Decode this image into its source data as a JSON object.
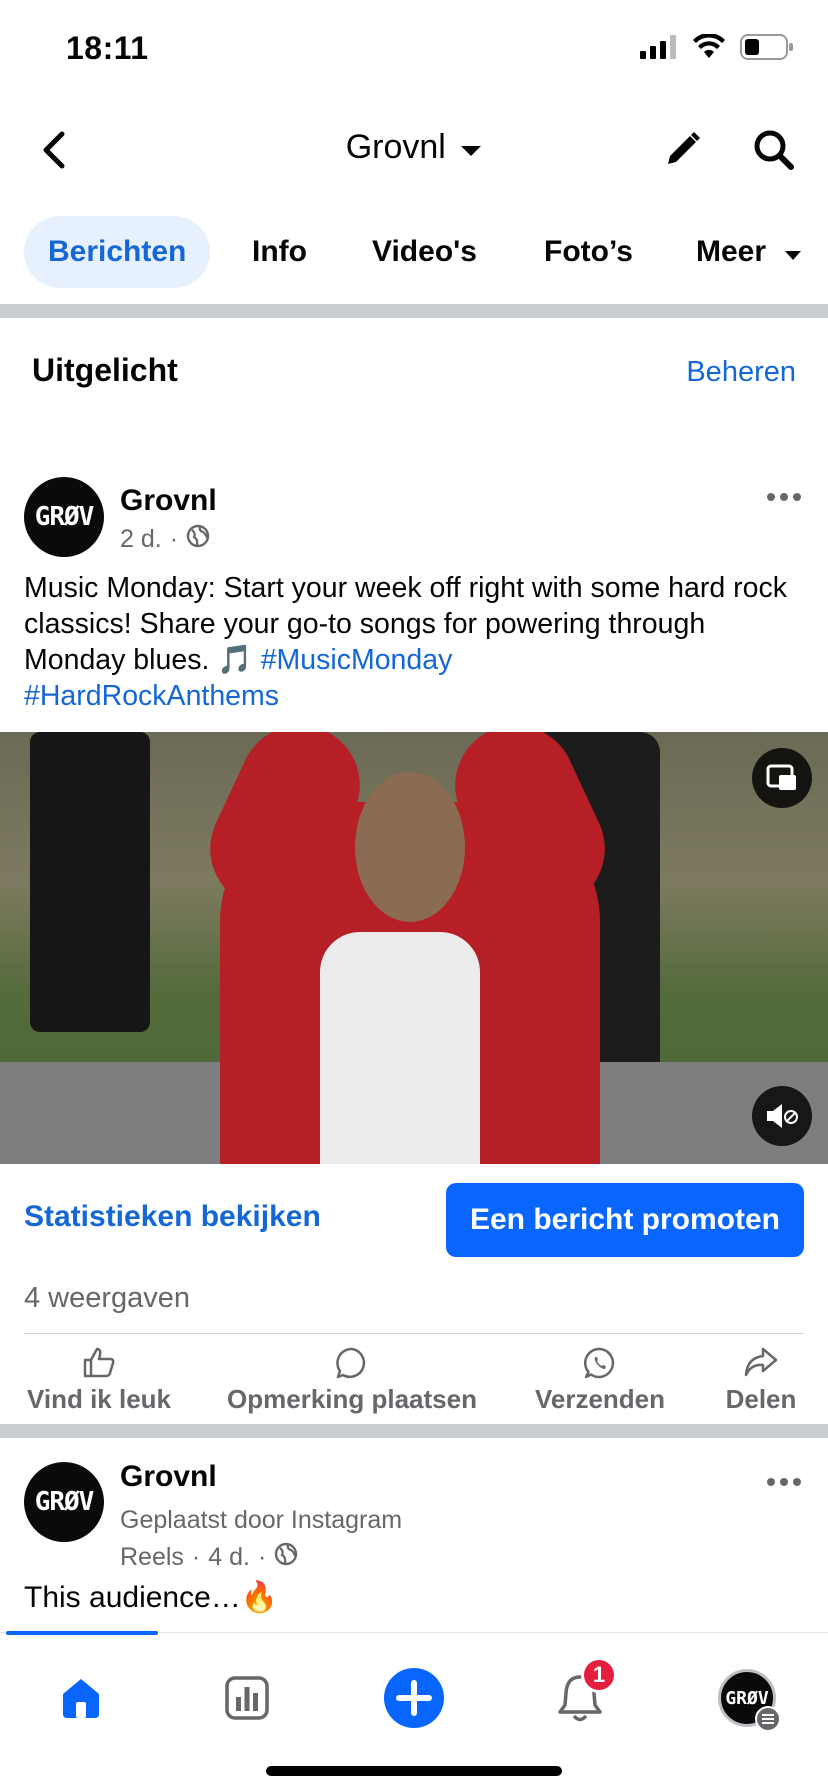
{
  "status_bar": {
    "time": "18:11"
  },
  "header": {
    "title": "Grovnl"
  },
  "tabs": [
    {
      "label": "Berichten",
      "active": true
    },
    {
      "label": "Info"
    },
    {
      "label": "Video's"
    },
    {
      "label": "Foto’s"
    },
    {
      "label": "Meer"
    }
  ],
  "featured": {
    "title": "Uitgelicht",
    "manage_label": "Beheren"
  },
  "post1": {
    "avatar_text": "GRØV",
    "author": "Grovnl",
    "time": "2 d.",
    "text": "Music Monday: Start your week off right with some hard rock classics! Share your go-to songs for powering through Monday blues. 🎵 ",
    "hashtags": [
      "#MusicMonday",
      "#HardRockAnthems"
    ],
    "stats_label": "Statistieken bekijken",
    "promote_label": "Een bericht promoten",
    "views": "4 weergaven",
    "actions": {
      "like": "Vind ik leuk",
      "comment": "Opmerking plaatsen",
      "send": "Verzenden",
      "share": "Delen"
    }
  },
  "post2": {
    "avatar_text": "GRØV",
    "author": "Grovnl",
    "posted_via": "Geplaatst door Instagram",
    "meta_prefix": "Reels",
    "time": "4 d.",
    "text": "This audience…🔥"
  },
  "bottom_nav": {
    "notifications_badge": "1",
    "profile_avatar_text": "GRØV"
  },
  "colors": {
    "accent": "#1467d6",
    "primary_button": "#0866ff",
    "badge": "#e41e3f",
    "tab_active_bg": "#e7f0fd"
  }
}
